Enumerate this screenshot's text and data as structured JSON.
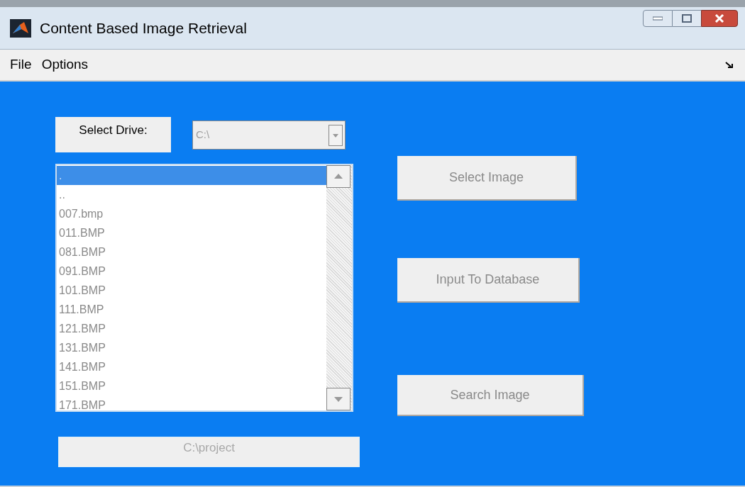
{
  "window": {
    "title": "Content Based Image Retrieval"
  },
  "menu": [
    "File",
    "Options"
  ],
  "drive_label": "Select Drive:",
  "drive_dropdown": {
    "value": "C:\\"
  },
  "file_list": [
    {
      "label": ".",
      "selected": true
    },
    {
      "label": "..",
      "selected": false
    },
    {
      "label": "007.bmp",
      "selected": false
    },
    {
      "label": "011.BMP",
      "selected": false
    },
    {
      "label": "081.BMP",
      "selected": false
    },
    {
      "label": "091.BMP",
      "selected": false
    },
    {
      "label": "101.BMP",
      "selected": false
    },
    {
      "label": "111.BMP",
      "selected": false
    },
    {
      "label": "121.BMP",
      "selected": false
    },
    {
      "label": "131.BMP",
      "selected": false
    },
    {
      "label": "141.BMP",
      "selected": false
    },
    {
      "label": "151.BMP",
      "selected": false
    },
    {
      "label": "171.BMP",
      "selected": false
    }
  ],
  "path_field": {
    "value": "C:\\project"
  },
  "buttons": [
    "Select Image",
    "Input To Database",
    "Search Image"
  ]
}
